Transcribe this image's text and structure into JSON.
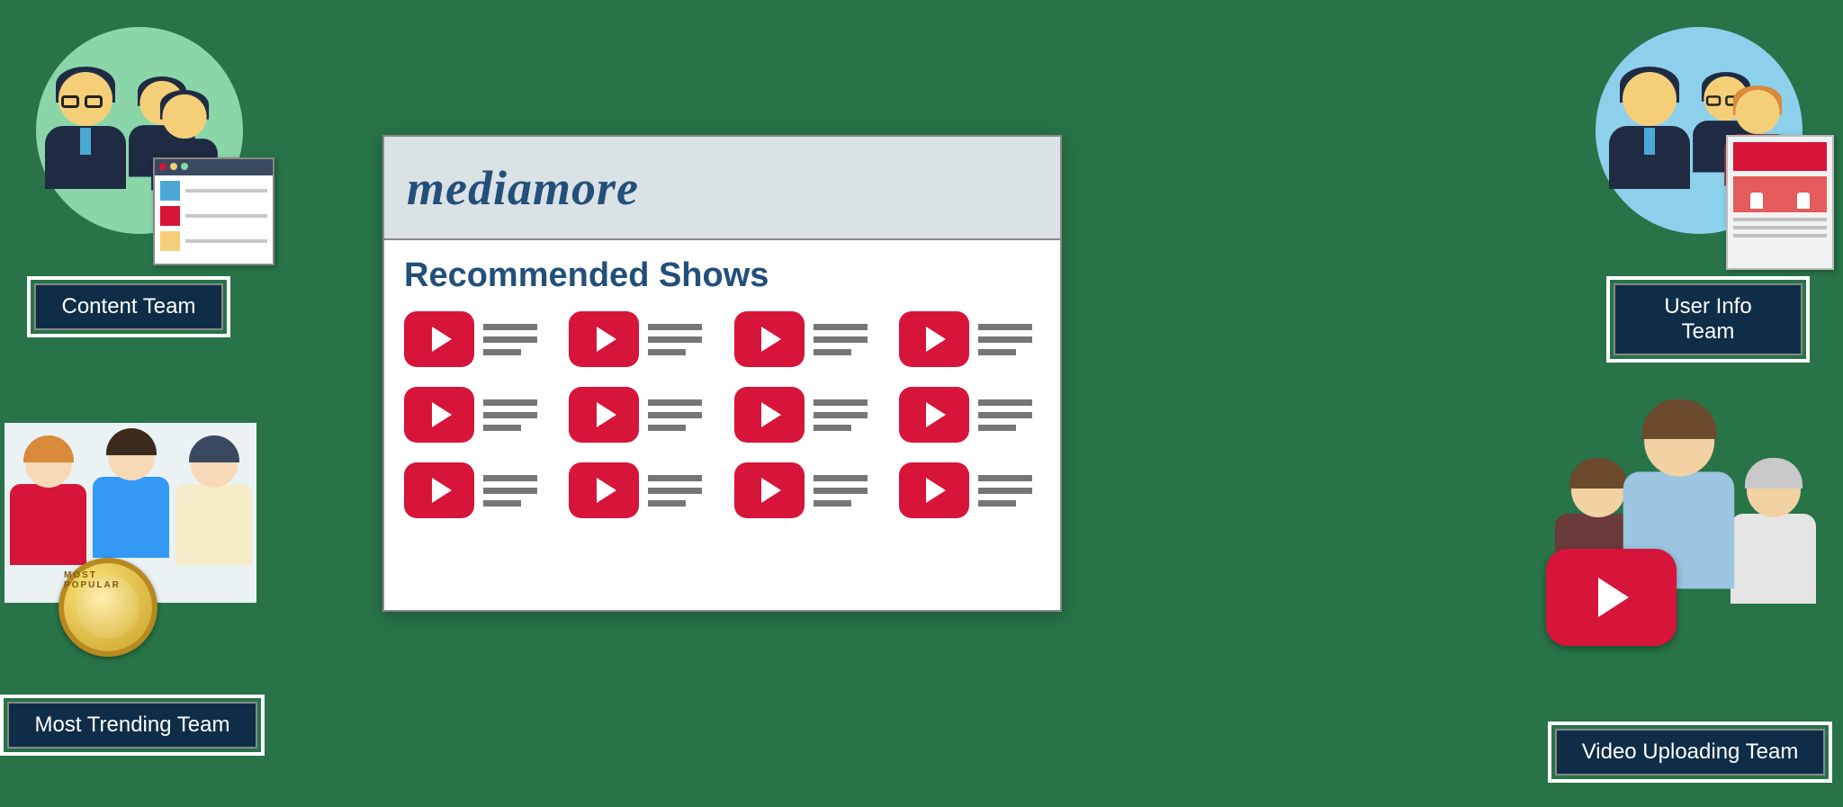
{
  "teams": {
    "content": {
      "label": "Content Team"
    },
    "trending": {
      "label": "Most Trending Team"
    },
    "userinfo": {
      "label": "User Info Team"
    },
    "video": {
      "label": "Video  Uploading Team"
    }
  },
  "panel": {
    "logo": "mediamore",
    "subtitle": "Recommended Shows"
  },
  "medal_text": "MOST POPULAR"
}
